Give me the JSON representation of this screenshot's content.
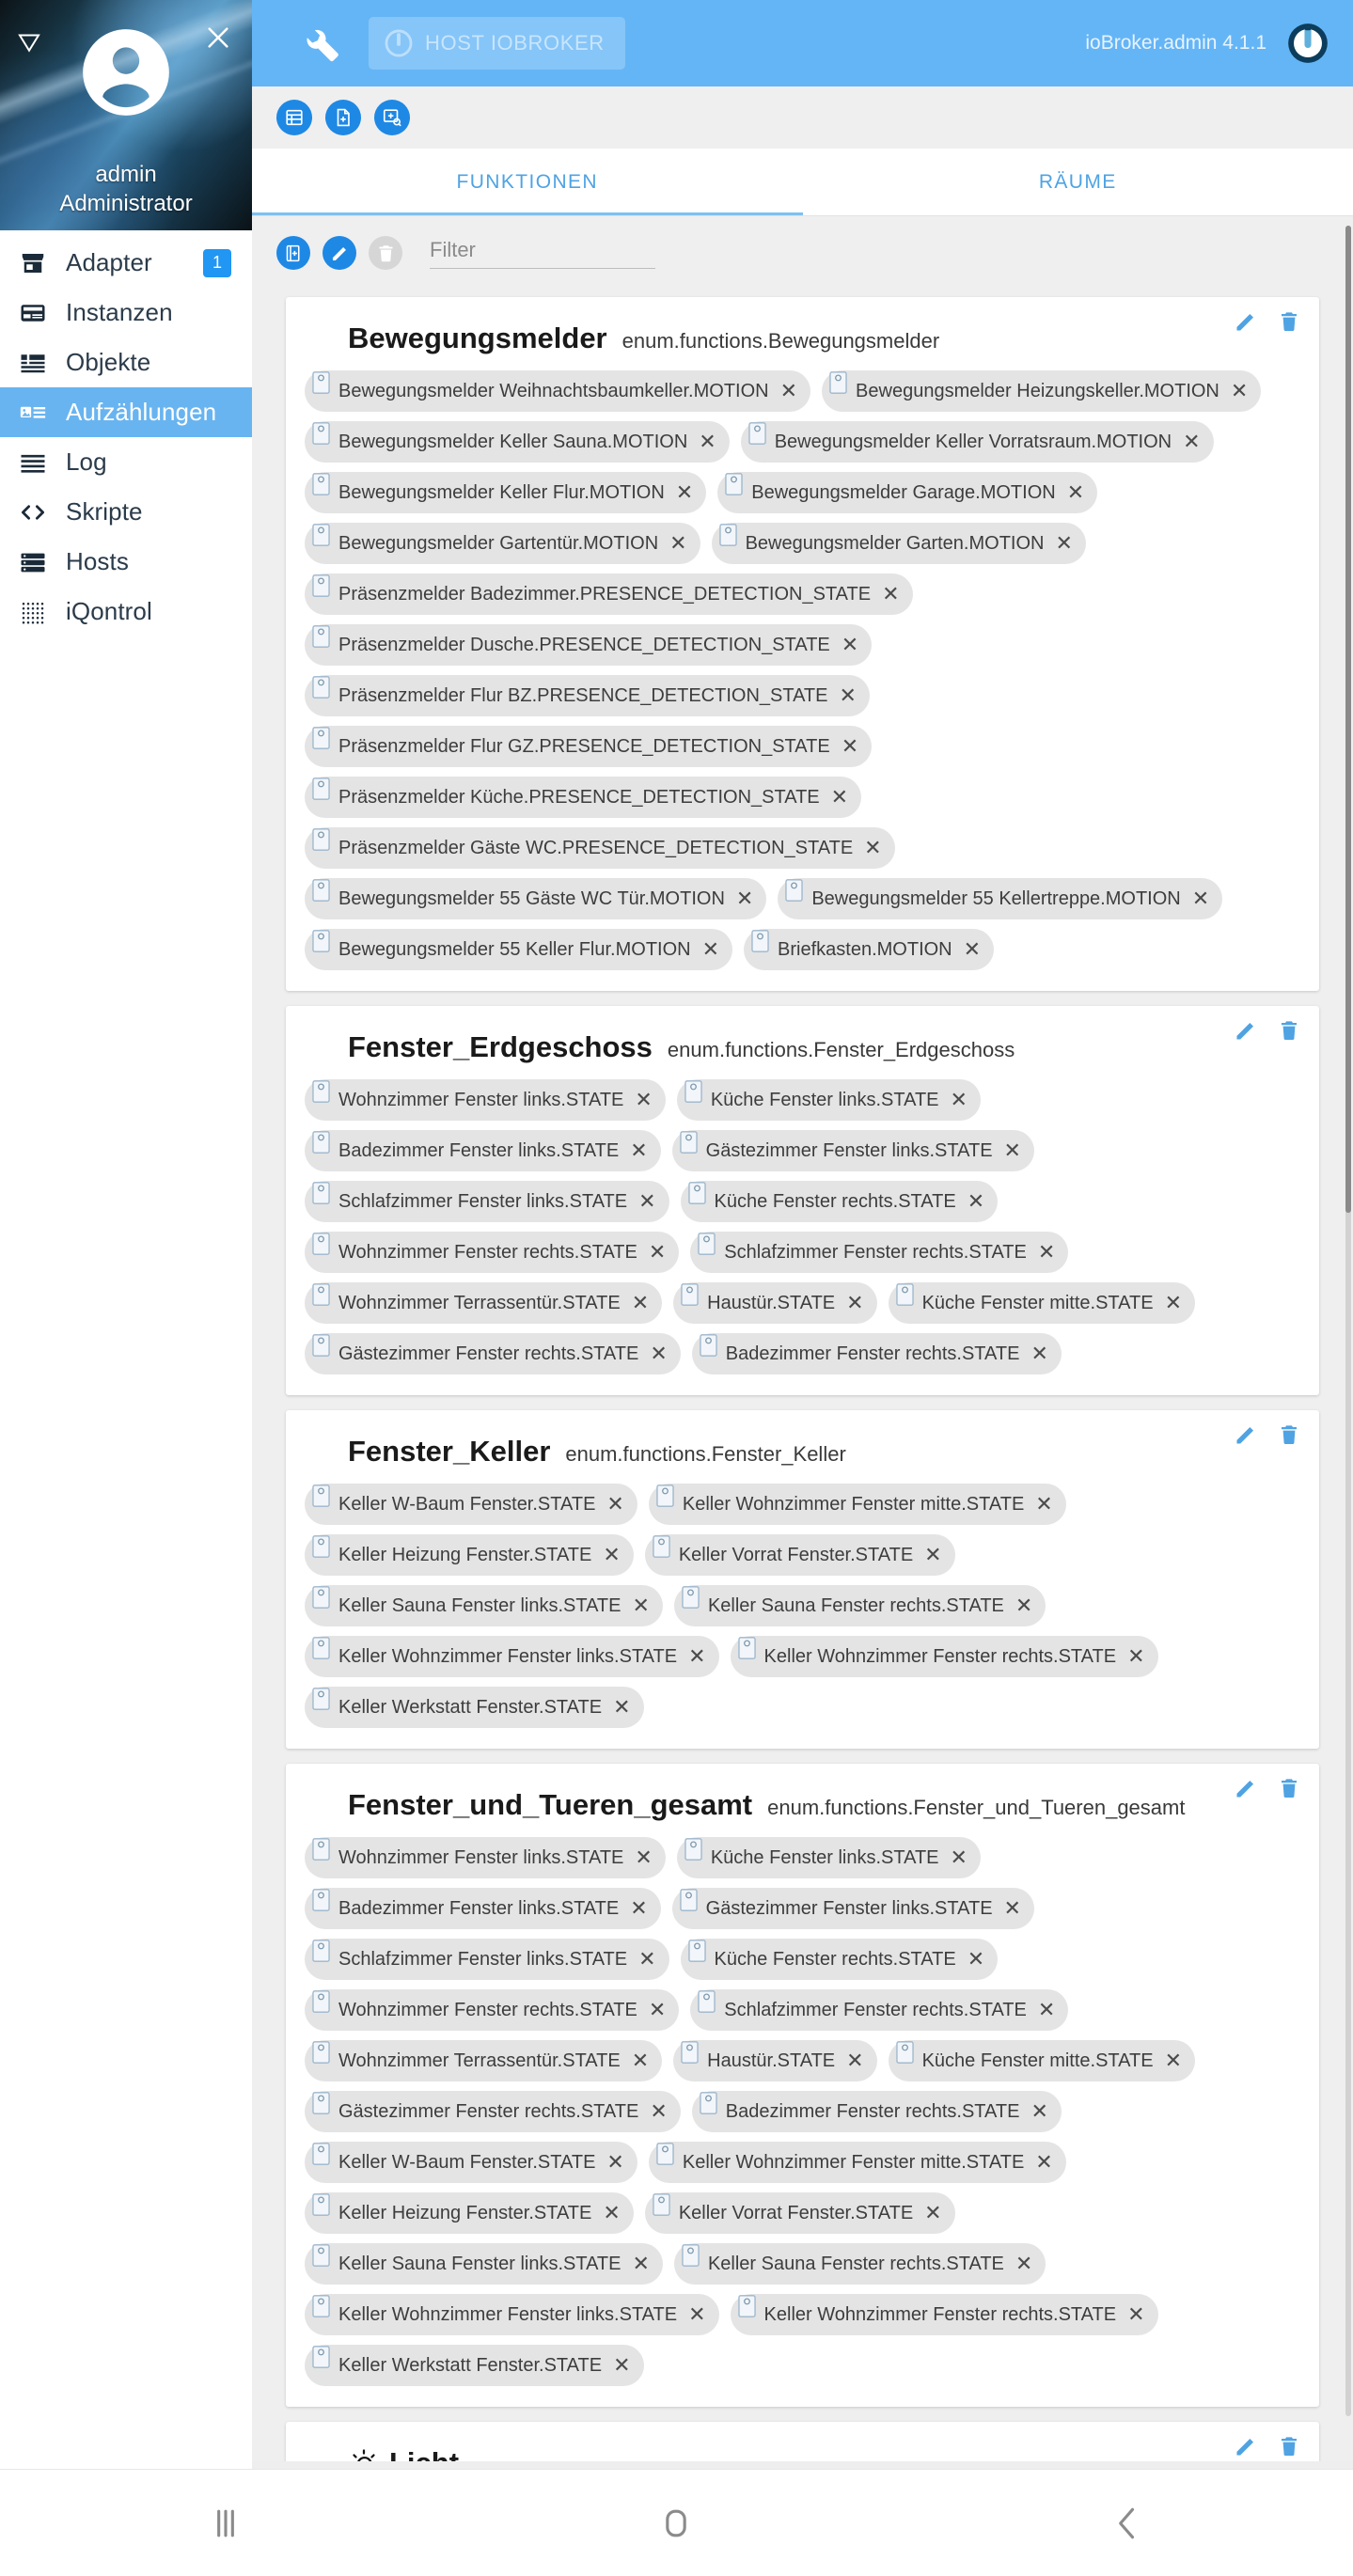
{
  "sidebar": {
    "user": {
      "name": "admin",
      "role": "Administrator"
    },
    "collapse_icon": "triangle-down-icon",
    "close_icon": "close-icon",
    "avatar_icon": "account-circle-icon",
    "items": [
      {
        "label": "Adapter",
        "icon": "store-icon",
        "badge": "1",
        "active": false
      },
      {
        "label": "Instanzen",
        "icon": "instances-icon",
        "badge": "",
        "active": false
      },
      {
        "label": "Objekte",
        "icon": "objects-icon",
        "badge": "",
        "active": false
      },
      {
        "label": "Aufzählungen",
        "icon": "enums-icon",
        "badge": "",
        "active": true
      },
      {
        "label": "Log",
        "icon": "log-icon",
        "badge": "",
        "active": false
      },
      {
        "label": "Skripte",
        "icon": "code-icon",
        "badge": "",
        "active": false
      },
      {
        "label": "Hosts",
        "icon": "hosts-icon",
        "badge": "",
        "active": false
      },
      {
        "label": "iQontrol",
        "icon": "grid-dots-icon",
        "badge": "",
        "active": false
      }
    ]
  },
  "appbar": {
    "menu_icon": "wrench-icon",
    "host_button_label": "HOST IOBROKER",
    "host_button_icon": "iobroker-power-icon",
    "version": "ioBroker.admin 4.1.1",
    "logo_icon": "iobroker-logo-icon",
    "accent_color": "#64b5f6"
  },
  "toolstrip": {
    "buttons": [
      {
        "icon": "list-icon",
        "name": "list-view-button"
      },
      {
        "icon": "file-add-icon",
        "name": "new-file-button"
      },
      {
        "icon": "window-add-icon",
        "name": "new-window-button"
      }
    ]
  },
  "tabs": [
    {
      "label": "FUNKTIONEN",
      "active": true
    },
    {
      "label": "RÄUME",
      "active": false
    }
  ],
  "filter": {
    "add_group_icon": "add-group-icon",
    "edit_icon": "pencil-icon",
    "delete_icon": "trash-icon",
    "placeholder": "Filter",
    "value": ""
  },
  "cards": [
    {
      "title": "Bewegungsmelder",
      "subtitle": "enum.functions.Bewegungsmelder",
      "edit_icon": "pencil-icon",
      "delete_icon": "trash-icon",
      "chips": [
        "Bewegungsmelder Weihnachtsbaumkeller.MOTION",
        "Bewegungsmelder Heizungskeller.MOTION",
        "Bewegungsmelder Keller Sauna.MOTION",
        "Bewegungsmelder Keller Vorratsraum.MOTION",
        "Bewegungsmelder Keller Flur.MOTION",
        "Bewegungsmelder Garage.MOTION",
        "Bewegungsmelder Gartentür.MOTION",
        "Bewegungsmelder Garten.MOTION",
        "Präsenzmelder Badezimmer.PRESENCE_DETECTION_STATE",
        "Präsenzmelder Dusche.PRESENCE_DETECTION_STATE",
        "Präsenzmelder Flur BZ.PRESENCE_DETECTION_STATE",
        "Präsenzmelder Flur GZ.PRESENCE_DETECTION_STATE",
        "Präsenzmelder Küche.PRESENCE_DETECTION_STATE",
        "Präsenzmelder Gäste WC.PRESENCE_DETECTION_STATE",
        "Bewegungsmelder 55 Gäste WC Tür.MOTION",
        "Bewegungsmelder 55 Kellertreppe.MOTION",
        "Bewegungsmelder 55 Keller Flur.MOTION",
        "Briefkasten.MOTION"
      ]
    },
    {
      "title": "Fenster_Erdgeschoss",
      "subtitle": "enum.functions.Fenster_Erdgeschoss",
      "edit_icon": "pencil-icon",
      "delete_icon": "trash-icon",
      "chips": [
        "Wohnzimmer Fenster links.STATE",
        "Küche Fenster links.STATE",
        "Badezimmer Fenster links.STATE",
        "Gästezimmer Fenster links.STATE",
        "Schlafzimmer Fenster links.STATE",
        "Küche Fenster rechts.STATE",
        "Wohnzimmer Fenster rechts.STATE",
        "Schlafzimmer Fenster rechts.STATE",
        "Wohnzimmer Terrassentür.STATE",
        "Haustür.STATE",
        "Küche Fenster mitte.STATE",
        "Gästezimmer Fenster rechts.STATE",
        "Badezimmer Fenster rechts.STATE"
      ]
    },
    {
      "title": "Fenster_Keller",
      "subtitle": "enum.functions.Fenster_Keller",
      "edit_icon": "pencil-icon",
      "delete_icon": "trash-icon",
      "chips": [
        "Keller W-Baum Fenster.STATE",
        "Keller Wohnzimmer Fenster mitte.STATE",
        "Keller Heizung Fenster.STATE",
        "Keller Vorrat Fenster.STATE",
        "Keller Sauna Fenster links.STATE",
        "Keller Sauna Fenster rechts.STATE",
        "Keller Wohnzimmer Fenster links.STATE",
        "Keller Wohnzimmer Fenster rechts.STATE",
        "Keller Werkstatt Fenster.STATE"
      ]
    },
    {
      "title": "Fenster_und_Tueren_gesamt",
      "subtitle": "enum.functions.Fenster_und_Tueren_gesamt",
      "edit_icon": "pencil-icon",
      "delete_icon": "trash-icon",
      "chips": [
        "Wohnzimmer Fenster links.STATE",
        "Küche Fenster links.STATE",
        "Badezimmer Fenster links.STATE",
        "Gästezimmer Fenster links.STATE",
        "Schlafzimmer Fenster links.STATE",
        "Küche Fenster rechts.STATE",
        "Wohnzimmer Fenster rechts.STATE",
        "Schlafzimmer Fenster rechts.STATE",
        "Wohnzimmer Terrassentür.STATE",
        "Haustür.STATE",
        "Küche Fenster mitte.STATE",
        "Gästezimmer Fenster rechts.STATE",
        "Badezimmer Fenster rechts.STATE",
        "Keller W-Baum Fenster.STATE",
        "Keller Wohnzimmer Fenster mitte.STATE",
        "Keller Heizung Fenster.STATE",
        "Keller Vorrat Fenster.STATE",
        "Keller Sauna Fenster links.STATE",
        "Keller Sauna Fenster rechts.STATE",
        "Keller Wohnzimmer Fenster links.STATE",
        "Keller Wohnzimmer Fenster rechts.STATE",
        "Keller Werkstatt Fenster.STATE"
      ]
    }
  ],
  "partial_card": {
    "icon": "light-bulb-icon",
    "title": "Licht",
    "edit_icon": "pencil-icon",
    "delete_icon": "trash-icon"
  },
  "navbar": {
    "recent_icon": "recent-apps-icon",
    "home_icon": "home-icon",
    "back_icon": "back-icon"
  }
}
